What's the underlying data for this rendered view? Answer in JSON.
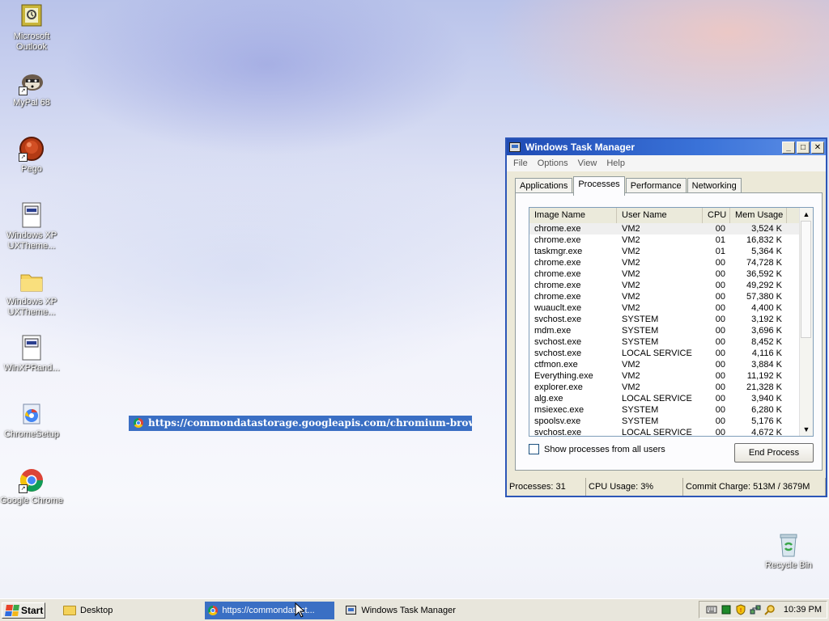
{
  "desktop": {
    "icons": [
      {
        "label": "Microsoft Outlook",
        "icon": "outlook-icon"
      },
      {
        "label": "MyPal 68",
        "icon": "mypal-icon"
      },
      {
        "label": "Pego",
        "icon": "pego-icon"
      },
      {
        "label": "Windows XP UXTheme...",
        "icon": "document-icon"
      },
      {
        "label": "Windows XP UXTheme...",
        "icon": "folder-icon"
      },
      {
        "label": "WinXPRand...",
        "icon": "document-icon"
      },
      {
        "label": "ChromeSetup",
        "icon": "setup-icon"
      },
      {
        "label": "Google Chrome",
        "icon": "chrome-icon"
      },
      {
        "label": "Recycle Bin",
        "icon": "recycle-bin-icon"
      }
    ],
    "drag_url": "https://commondatastorage.googleapis.com/chromium-browser-snap"
  },
  "task_manager": {
    "title": "Windows Task Manager",
    "menu": [
      "File",
      "Options",
      "View",
      "Help"
    ],
    "tabs": [
      "Applications",
      "Processes",
      "Performance",
      "Networking"
    ],
    "active_tab": "Processes",
    "columns": [
      "Image Name",
      "User Name",
      "CPU",
      "Mem Usage"
    ],
    "processes": [
      {
        "name": "chrome.exe",
        "user": "VM2",
        "cpu": "00",
        "mem": "3,524 K"
      },
      {
        "name": "chrome.exe",
        "user": "VM2",
        "cpu": "01",
        "mem": "16,832 K"
      },
      {
        "name": "taskmgr.exe",
        "user": "VM2",
        "cpu": "01",
        "mem": "5,364 K"
      },
      {
        "name": "chrome.exe",
        "user": "VM2",
        "cpu": "00",
        "mem": "74,728 K"
      },
      {
        "name": "chrome.exe",
        "user": "VM2",
        "cpu": "00",
        "mem": "36,592 K"
      },
      {
        "name": "chrome.exe",
        "user": "VM2",
        "cpu": "00",
        "mem": "49,292 K"
      },
      {
        "name": "chrome.exe",
        "user": "VM2",
        "cpu": "00",
        "mem": "57,380 K"
      },
      {
        "name": "wuauclt.exe",
        "user": "VM2",
        "cpu": "00",
        "mem": "4,400 K"
      },
      {
        "name": "svchost.exe",
        "user": "SYSTEM",
        "cpu": "00",
        "mem": "3,192 K"
      },
      {
        "name": "mdm.exe",
        "user": "SYSTEM",
        "cpu": "00",
        "mem": "3,696 K"
      },
      {
        "name": "svchost.exe",
        "user": "SYSTEM",
        "cpu": "00",
        "mem": "8,452 K"
      },
      {
        "name": "svchost.exe",
        "user": "LOCAL SERVICE",
        "cpu": "00",
        "mem": "4,116 K"
      },
      {
        "name": "ctfmon.exe",
        "user": "VM2",
        "cpu": "00",
        "mem": "3,884 K"
      },
      {
        "name": "Everything.exe",
        "user": "VM2",
        "cpu": "00",
        "mem": "11,192 K"
      },
      {
        "name": "explorer.exe",
        "user": "VM2",
        "cpu": "00",
        "mem": "21,328 K"
      },
      {
        "name": "alg.exe",
        "user": "LOCAL SERVICE",
        "cpu": "00",
        "mem": "3,940 K"
      },
      {
        "name": "msiexec.exe",
        "user": "SYSTEM",
        "cpu": "00",
        "mem": "6,280 K"
      },
      {
        "name": "spoolsv.exe",
        "user": "SYSTEM",
        "cpu": "00",
        "mem": "5,176 K"
      },
      {
        "name": "svchost.exe",
        "user": "LOCAL SERVICE",
        "cpu": "00",
        "mem": "4,672 K"
      }
    ],
    "show_all_users_label": "Show processes from all users",
    "show_all_users_checked": false,
    "end_process_label": "End Process",
    "status": {
      "processes": "Processes: 31",
      "cpu": "CPU Usage: 3%",
      "commit": "Commit Charge: 513M / 3679M"
    }
  },
  "taskbar": {
    "start_label": "Start",
    "items": [
      {
        "label": "Desktop",
        "icon": "folder-icon",
        "active": false
      },
      {
        "label": "https://commondatast...",
        "icon": "chrome-icon",
        "active": true
      },
      {
        "label": "Windows Task Manager",
        "icon": "task-manager-icon",
        "active": false
      }
    ],
    "clock": "10:39 PM"
  },
  "colors": {
    "selection": "#3a6fc4",
    "titlebar": "#1f4bb4",
    "window_face": "#ece9d8"
  }
}
